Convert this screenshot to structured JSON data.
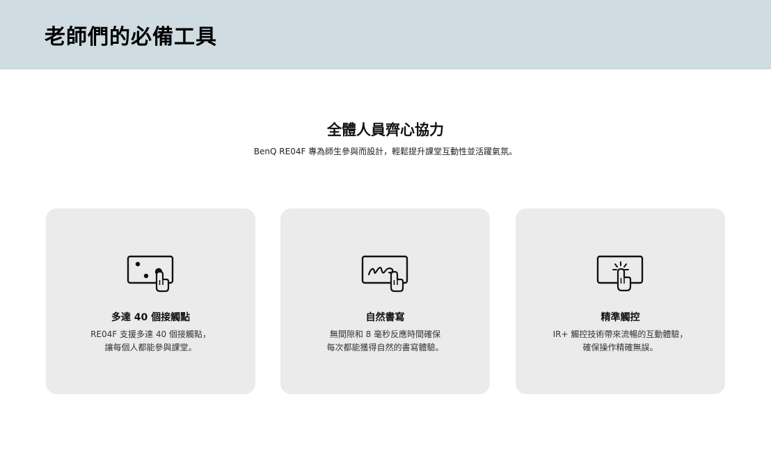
{
  "colors": {
    "banner_bg": "#cfdce2",
    "card_bg": "#ebebeb",
    "page_bg": "#ffffff",
    "text": "#111111"
  },
  "banner": {
    "title": "老師們的必備工具"
  },
  "section": {
    "title": "全體人員齊心協力",
    "subtitle": "BenQ RE04F 專為師生參與而設計，輕鬆提升課堂互動性並活躍氣氛。"
  },
  "features": [
    {
      "icon": "multi-touch-icon",
      "title": "多達 40 個接觸點",
      "desc_line1": "RE04F 支援多達 40 個接觸點，",
      "desc_line2": "讓每個人都能參與課堂。"
    },
    {
      "icon": "handwriting-icon",
      "title": "自然書寫",
      "desc_line1": "無間隙和 8 毫秒反應時間確保",
      "desc_line2": "每次都能獲得自然的書寫體驗。"
    },
    {
      "icon": "precise-touch-icon",
      "title": "精準觸控",
      "desc_line1": "IR+ 觸控技術帶來流暢的互動體驗，",
      "desc_line2": "確保操作精確無誤。"
    }
  ]
}
